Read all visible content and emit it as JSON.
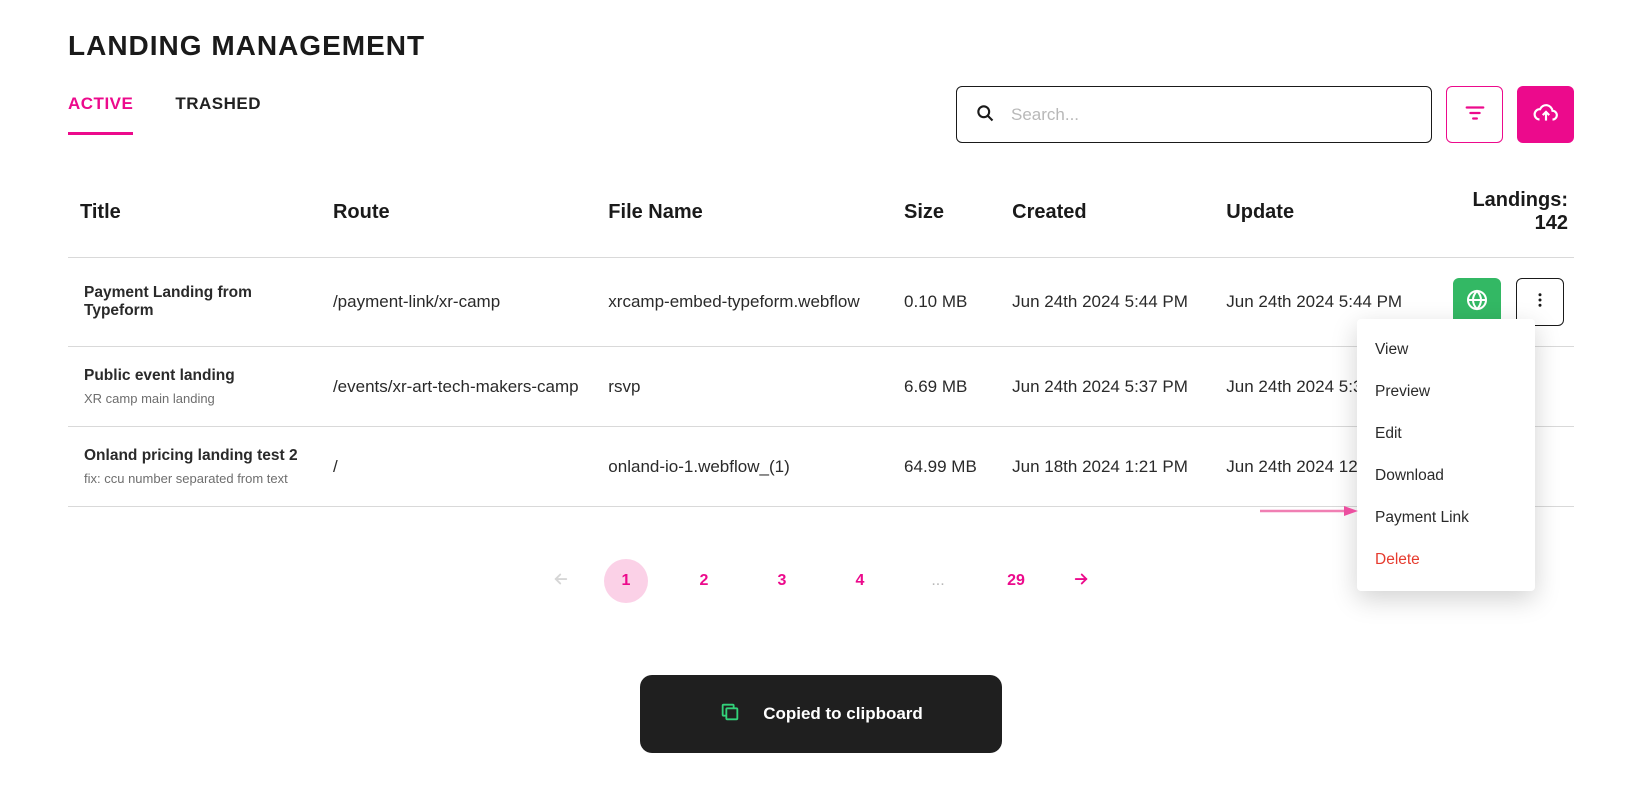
{
  "pageTitle": "LANDING MANAGEMENT",
  "tabs": {
    "active": "ACTIVE",
    "trashed": "TRASHED"
  },
  "search": {
    "placeholder": "Search..."
  },
  "headers": {
    "title": "Title",
    "route": "Route",
    "file": "File Name",
    "size": "Size",
    "created": "Created",
    "update": "Update",
    "landingsLabel": "Landings: ",
    "landingsCount": "142"
  },
  "rows": [
    {
      "title": "Payment Landing from Typeform",
      "subtitle": "",
      "route": "/payment-link/xr-camp",
      "file": "xrcamp-embed-typeform.webflow",
      "size": "0.10 MB",
      "created": "Jun 24th 2024 5:44 PM",
      "update": "Jun 24th 2024 5:44 PM"
    },
    {
      "title": "Public event landing",
      "subtitle": "XR camp main landing",
      "route": "/events/xr-art-tech-makers-camp",
      "file": "rsvp",
      "size": "6.69 MB",
      "created": "Jun 24th 2024 5:37 PM",
      "update": "Jun 24th 2024 5:38 PM"
    },
    {
      "title": "Onland pricing landing test 2",
      "subtitle": "fix: ccu number separated from text",
      "route": "/",
      "file": "onland-io-1.webflow_(1)",
      "size": "64.99 MB",
      "created": "Jun 18th 2024 1:21 PM",
      "update": "Jun 24th 2024 12:36 PM"
    }
  ],
  "pagination": {
    "pages": [
      "1",
      "2",
      "3",
      "4"
    ],
    "ellipsis": "...",
    "last": "29"
  },
  "contextMenu": {
    "view": "View",
    "preview": "Preview",
    "edit": "Edit",
    "download": "Download",
    "paymentLink": "Payment Link",
    "delete": "Delete"
  },
  "toast": "Copied to clipboard"
}
